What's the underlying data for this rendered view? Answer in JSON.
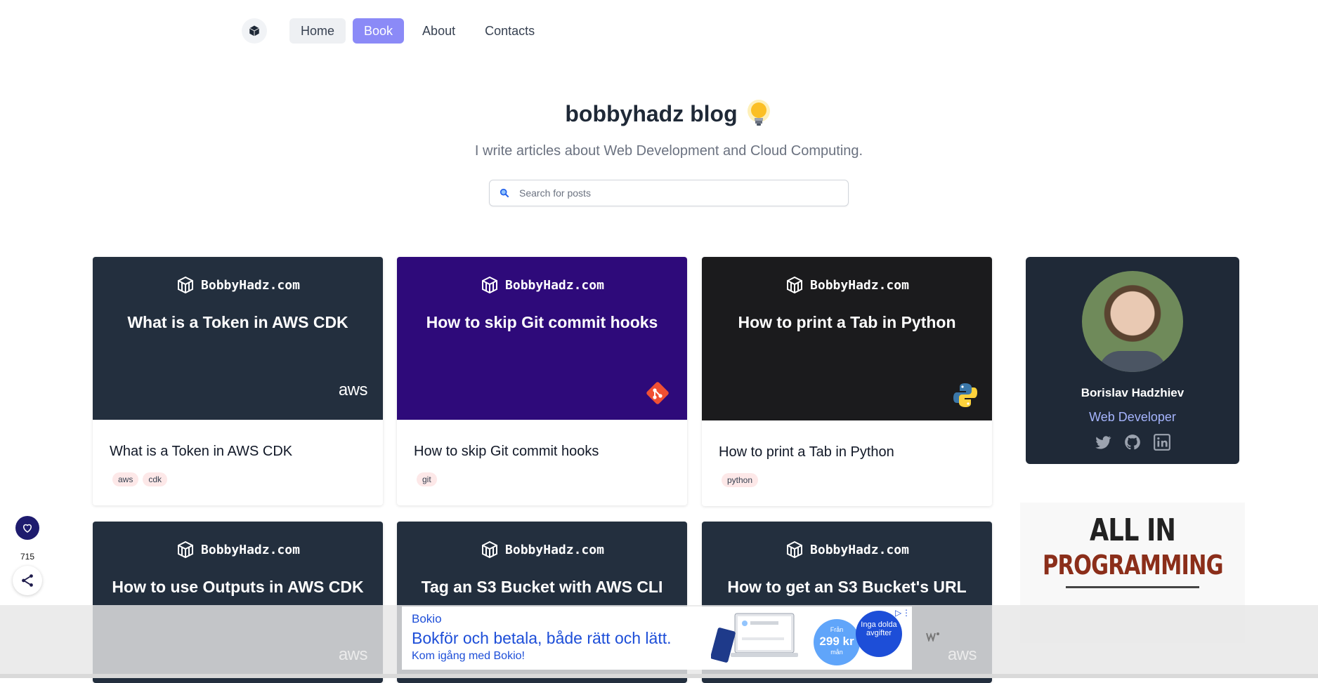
{
  "nav": {
    "logo_icon": "cube-icon",
    "items": [
      {
        "label": "Home"
      },
      {
        "label": "Book"
      },
      {
        "label": "About"
      },
      {
        "label": "Contacts"
      }
    ]
  },
  "hero": {
    "title": "bobbyhadz blog",
    "title_icon": "lightbulb-icon",
    "subtitle": "I write articles about Web Development and Cloud Computing.",
    "search_placeholder": "Search for posts"
  },
  "brand_label": "BobbyHadz.com",
  "posts": [
    {
      "image_title": "What is a Token in AWS CDK",
      "title": "What is a Token in AWS CDK",
      "tags": [
        "aws",
        "cdk"
      ],
      "bg": "#232f3e",
      "badge": "aws"
    },
    {
      "image_title": "How to skip Git commit hooks",
      "title": "How to skip Git commit hooks",
      "tags": [
        "git"
      ],
      "bg": "#2e0a7a",
      "badge": "git-icon"
    },
    {
      "image_title": "How to print a Tab in Python",
      "title": "How to print a Tab in Python",
      "tags": [
        "python"
      ],
      "bg": "#1b1b1d",
      "badge": "python-icon"
    },
    {
      "image_title": "How to use Outputs in AWS CDK",
      "bg": "#232f3e",
      "badge": "aws"
    },
    {
      "image_title": "Tag an S3 Bucket with AWS CLI",
      "bg": "#232f3e",
      "badge": "aws"
    },
    {
      "image_title": "How to get an S3 Bucket's URL",
      "bg": "#232f3e",
      "badge": "aws"
    }
  ],
  "profile": {
    "name": "Borislav Hadzhiev",
    "role": "Web Developer",
    "socials": [
      "twitter-icon",
      "github-icon",
      "linkedin-icon"
    ]
  },
  "promo": {
    "line1": "ALL IN",
    "line2": "PROGRAMMING"
  },
  "floating": {
    "like_count": "715"
  },
  "ad": {
    "brand": "Bokio",
    "headline": "Bokför och betala, både rätt och lätt.",
    "sub": "Kom igång med Bokio!",
    "price_top": "Från",
    "price": "299 kr",
    "price_unit": "mån",
    "badge": "Inga dolda avgifter"
  }
}
